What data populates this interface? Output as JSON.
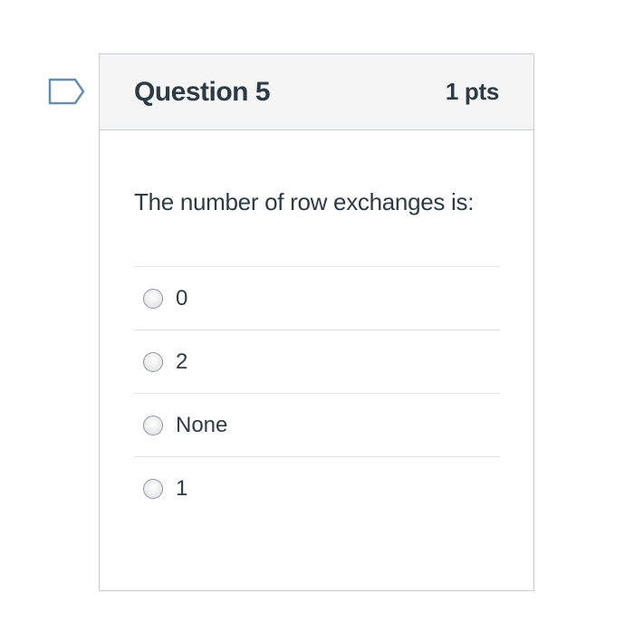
{
  "question": {
    "title": "Question 5",
    "points": "1 pts",
    "text": "The number of row exchanges is:",
    "flag_icon": "flag-outline-icon"
  },
  "answers": [
    {
      "label": "0"
    },
    {
      "label": "2"
    },
    {
      "label": "None"
    },
    {
      "label": "1"
    }
  ],
  "colors": {
    "text": "#2d3b45",
    "border": "#c7cdd1",
    "header_bg": "#f5f5f5",
    "flag_stroke": "#5b7fa0"
  }
}
